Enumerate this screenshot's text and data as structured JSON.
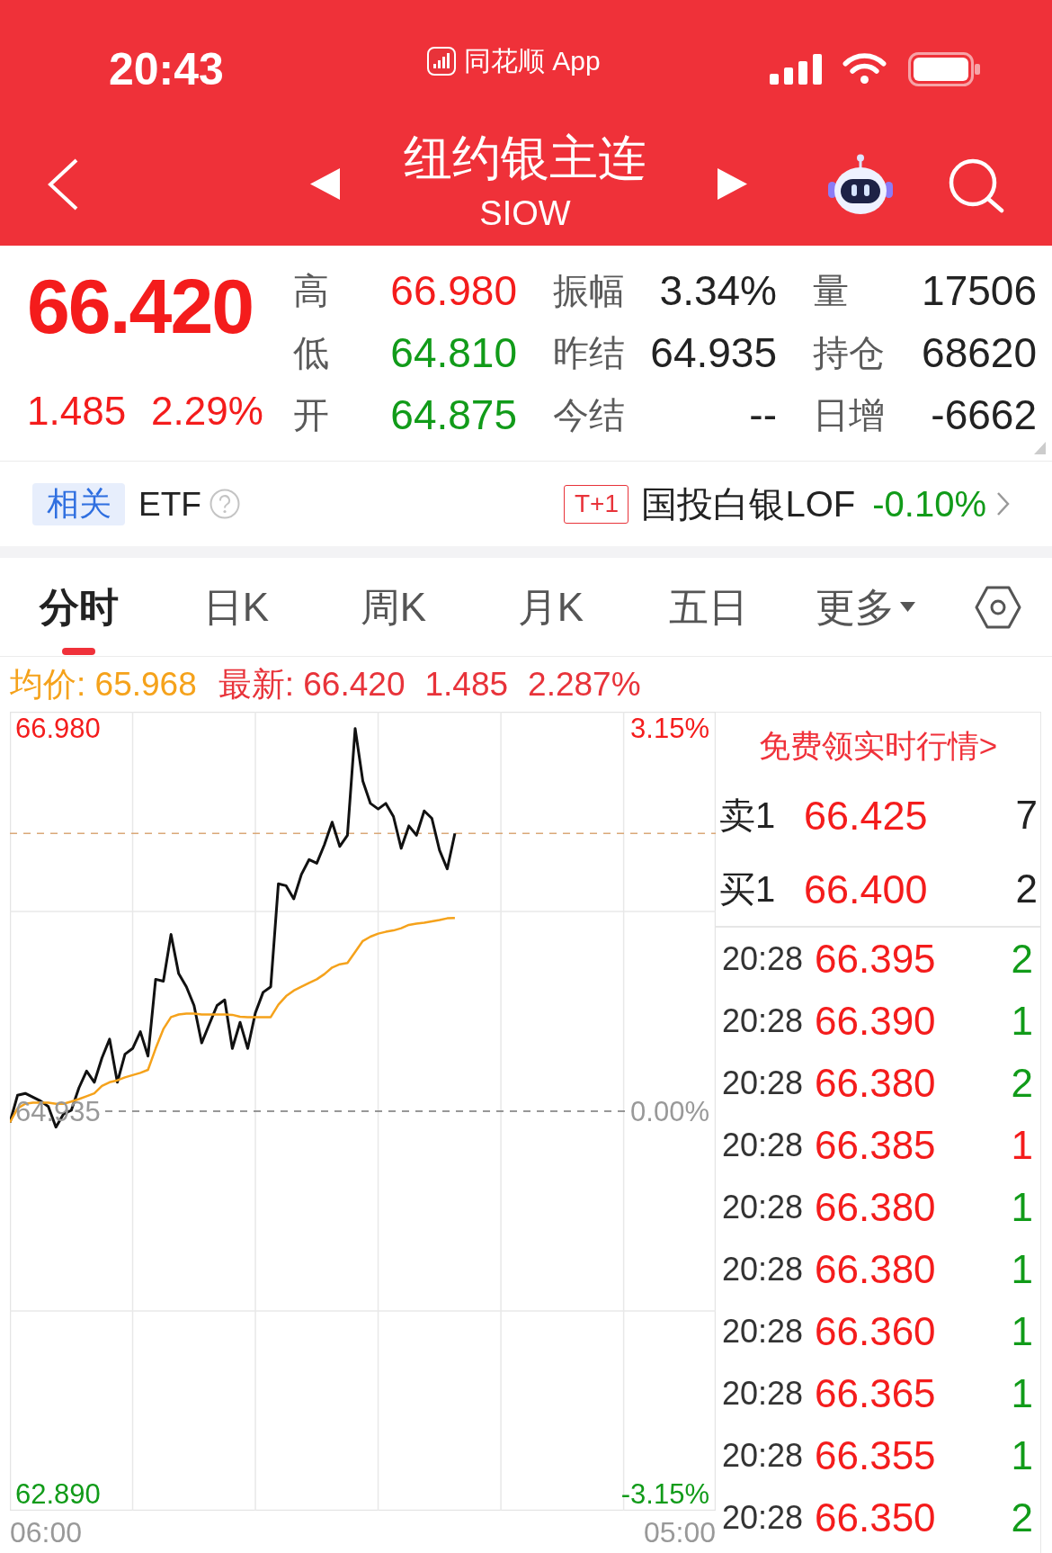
{
  "status_bar": {
    "time": "20:43",
    "app_name": "同花顺 App"
  },
  "nav": {
    "title": "纽约银主连",
    "code": "SIOW"
  },
  "quote": {
    "price": "66.420",
    "change": "1.485",
    "change_percent": "2.29%",
    "fields": [
      {
        "label": "高",
        "value": "66.980",
        "color": "#f41c1c"
      },
      {
        "label": "振幅",
        "value": "3.34%",
        "color": "#222222"
      },
      {
        "label": "量",
        "value": "17506",
        "color": "#222222"
      },
      {
        "label": "低",
        "value": "64.810",
        "color": "#119b19"
      },
      {
        "label": "昨结",
        "value": "64.935",
        "color": "#222222"
      },
      {
        "label": "持仓",
        "value": "68620",
        "color": "#222222"
      },
      {
        "label": "开",
        "value": "64.875",
        "color": "#119b19"
      },
      {
        "label": "今结",
        "value": "--",
        "color": "#222222"
      },
      {
        "label": "日增",
        "value": "-6662",
        "color": "#222222"
      }
    ]
  },
  "related": {
    "tag": "相关",
    "label": "ETF",
    "badge": "T+1",
    "fund": "国投白银LOF",
    "change": "-0.10%"
  },
  "tabs": [
    {
      "label": "分时",
      "selected": true,
      "kind": "tab"
    },
    {
      "label": "日K",
      "selected": false,
      "kind": "tab"
    },
    {
      "label": "周K",
      "selected": false,
      "kind": "tab"
    },
    {
      "label": "月K",
      "selected": false,
      "kind": "tab"
    },
    {
      "label": "五日",
      "selected": false,
      "kind": "tab"
    },
    {
      "label": "更多",
      "selected": false,
      "kind": "menu"
    }
  ],
  "summary": {
    "average": "均价: 65.968",
    "latest": "最新: 66.420",
    "change": "1.485",
    "change_percent": "2.287%"
  },
  "chart": {
    "change_labels": [
      "3.15%",
      "0.00%",
      "-3.15%"
    ],
    "time_labels": [
      "06:00",
      "05:00"
    ],
    "chart_data": {
      "type": "line",
      "categories": [
        null,
        null,
        null,
        null,
        null,
        null,
        null,
        null,
        null,
        null,
        null,
        null,
        null,
        null,
        null,
        null,
        null,
        null,
        null,
        null,
        null,
        null,
        null,
        null,
        null,
        null,
        null,
        null,
        null,
        null,
        null,
        null,
        null,
        null,
        null,
        null,
        null,
        null,
        null,
        null,
        null,
        null,
        null,
        null,
        null,
        null,
        null,
        null,
        null,
        null,
        null,
        null,
        null,
        null,
        null,
        null,
        null,
        null,
        null,
        null,
        null,
        null,
        null,
        null,
        null,
        null,
        null,
        null,
        null,
        null,
        null,
        null,
        null,
        null,
        null,
        null,
        null,
        null,
        null,
        null,
        null,
        null,
        null,
        null,
        null,
        null,
        null,
        null,
        null,
        null,
        null,
        null,
        null
      ],
      "series": [
        {
          "color": "#111111",
          "values": [
            64.875,
            65.02,
            65.03,
            65.01,
            64.99,
            64.96,
            64.85,
            64.92,
            64.94,
            65.06,
            65.15,
            65.09,
            65.22,
            65.32,
            65.09,
            65.24,
            65.27,
            65.36,
            65.23,
            65.64,
            65.63,
            65.88,
            65.67,
            65.6,
            65.5,
            65.3,
            65.4,
            65.5,
            65.53,
            65.27,
            65.41,
            65.27,
            65.46,
            65.57,
            65.6,
            66.15,
            66.14,
            66.07,
            66.2,
            66.28,
            66.26,
            66.36,
            66.48,
            66.35,
            66.41,
            66.98,
            66.7,
            66.58,
            66.55,
            66.58,
            66.51,
            66.34,
            66.46,
            66.41,
            66.54,
            66.5,
            66.33,
            66.23,
            66.42,
            null,
            null,
            null,
            null,
            null,
            null,
            null,
            null,
            null,
            null,
            null,
            null,
            null,
            null,
            null,
            null,
            null,
            null,
            null,
            null,
            null,
            null,
            null,
            null,
            null,
            null,
            null,
            null,
            null,
            null,
            null,
            null,
            null,
            null
          ]
        },
        {
          "color": "#f5a21b",
          "values": [
            64.875,
            64.95,
            64.975,
            64.98,
            64.98,
            64.98,
            64.975,
            64.975,
            64.987,
            65.0,
            65.015,
            65.03,
            65.07,
            65.09,
            65.1,
            65.116,
            65.128,
            65.14,
            65.156,
            65.27,
            65.374,
            65.438,
            65.452,
            65.457,
            65.457,
            65.452,
            65.452,
            65.452,
            65.452,
            65.45,
            65.44,
            65.438,
            65.438,
            65.438,
            65.438,
            65.504,
            65.55,
            65.58,
            65.6,
            65.621,
            65.64,
            65.668,
            65.703,
            65.72,
            65.727,
            65.786,
            65.845,
            65.868,
            65.884,
            65.894,
            65.901,
            65.913,
            65.931,
            65.938,
            65.943,
            65.95,
            65.957,
            65.966,
            65.968,
            null,
            null,
            null,
            null,
            null,
            null,
            null,
            null,
            null,
            null,
            null,
            null,
            null,
            null,
            null,
            null,
            null,
            null,
            null,
            null,
            null,
            null,
            null,
            null,
            null,
            null,
            null,
            null,
            null,
            null,
            null,
            null,
            null,
            null
          ]
        }
      ],
      "ylim": [
        62.8,
        67.07
      ],
      "yticks": [
        {
          "value": 66.98,
          "label": "66.980"
        },
        {
          "value": 64.935,
          "label": "64.935"
        },
        {
          "value": 62.89,
          "label": "62.890"
        }
      ],
      "grid": true,
      "ref_lines": [
        {
          "axis": "y",
          "value": 64.935,
          "color": "#777777"
        },
        {
          "axis": "y",
          "value": 66.42,
          "color": "#d9a878"
        }
      ]
    }
  },
  "side_panel": {
    "link": "免费领实时行情>",
    "book": [
      {
        "label": "卖1",
        "price": "66.425",
        "volume": "7"
      },
      {
        "label": "买1",
        "price": "66.400",
        "volume": "2"
      }
    ],
    "trades": [
      {
        "time": "20:28",
        "price": "66.395",
        "volume": "2",
        "color": "#119b19"
      },
      {
        "time": "20:28",
        "price": "66.390",
        "volume": "1",
        "color": "#119b19"
      },
      {
        "time": "20:28",
        "price": "66.380",
        "volume": "2",
        "color": "#119b19"
      },
      {
        "time": "20:28",
        "price": "66.385",
        "volume": "1",
        "color": "#f41c1c"
      },
      {
        "time": "20:28",
        "price": "66.380",
        "volume": "1",
        "color": "#119b19"
      },
      {
        "time": "20:28",
        "price": "66.380",
        "volume": "1",
        "color": "#119b19"
      },
      {
        "time": "20:28",
        "price": "66.360",
        "volume": "1",
        "color": "#119b19"
      },
      {
        "time": "20:28",
        "price": "66.365",
        "volume": "1",
        "color": "#119b19"
      },
      {
        "time": "20:28",
        "price": "66.355",
        "volume": "1",
        "color": "#119b19"
      },
      {
        "time": "20:28",
        "price": "66.350",
        "volume": "2",
        "color": "#119b19"
      }
    ]
  }
}
